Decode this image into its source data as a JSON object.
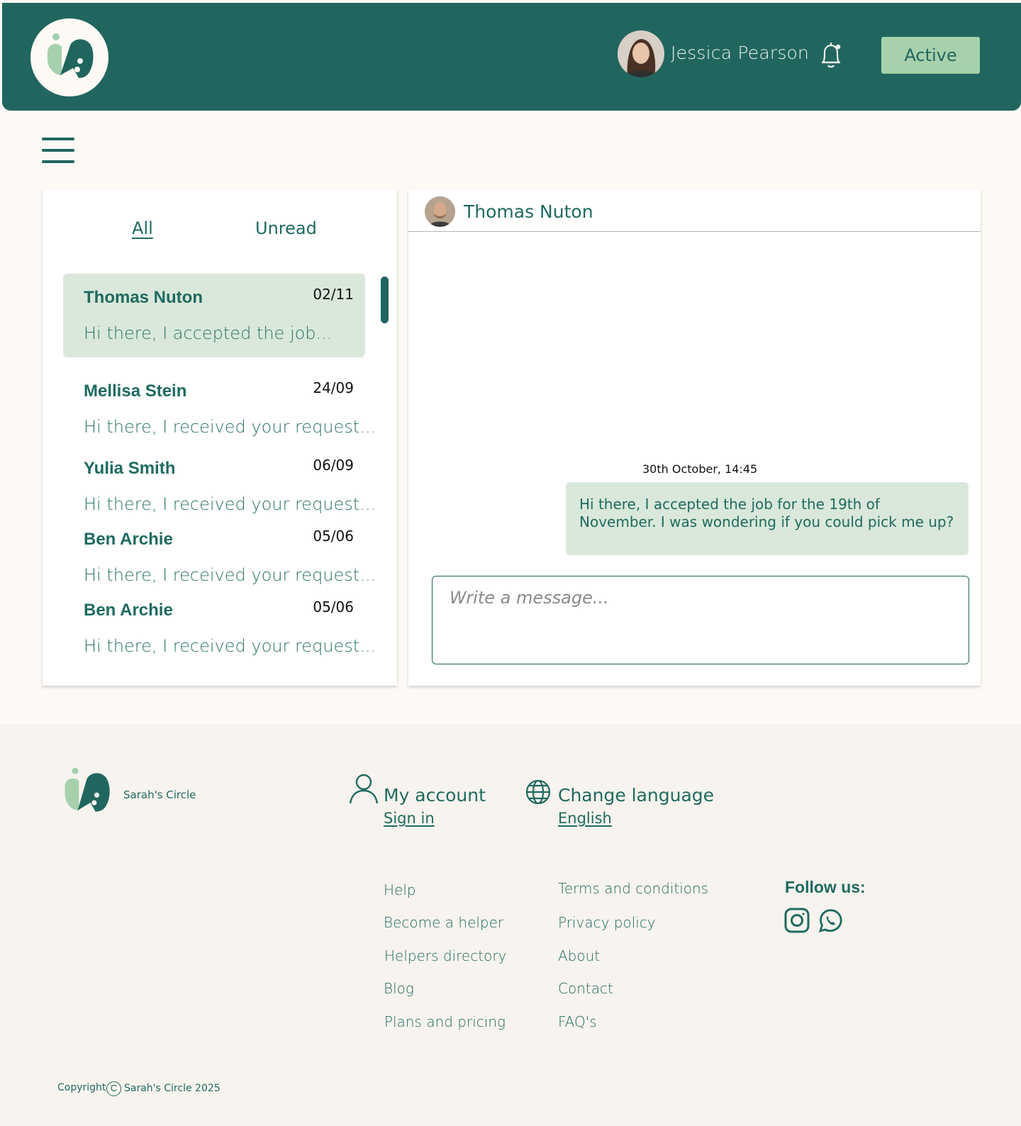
{
  "header": {
    "user_name": "Jessica Pearson",
    "status_label": "Active",
    "colors": {
      "header_bg": "#20665f",
      "status_bg": "#a6d1ac",
      "page_bg": "#fdf9f5"
    }
  },
  "tabs": {
    "all": "All",
    "unread": "Unread"
  },
  "conversations": [
    {
      "name": "Thomas Nuton",
      "date": "02/11",
      "preview": "Hi there, I accepted the job...",
      "active": true
    },
    {
      "name": "Mellisa Stein",
      "date": "24/09",
      "preview": "Hi there, I received your request..."
    },
    {
      "name": "Yulia Smith",
      "date": "06/09",
      "preview": "Hi there, I received your request..."
    },
    {
      "name": "Ben Archie",
      "date": "05/06",
      "preview": "Hi there, I received your request..."
    },
    {
      "name": "Ben Archie",
      "date": "05/06",
      "preview": "Hi there, I received your request..."
    }
  ],
  "chat": {
    "contact_name": "Thomas Nuton",
    "message_time": "30th October, 14:45",
    "message_text": "Hi there, I accepted the job for the 19th of November. I was wondering if you could pick me up?",
    "input_placeholder": "Write a message..."
  },
  "footer": {
    "brand": "Sarah's Circle",
    "account_heading": "My account",
    "account_link": "Sign in",
    "language_heading": "Change language",
    "language_link": "English",
    "links_col1": [
      "Help",
      "Become a helper",
      "Helpers directory",
      "Blog",
      "Plans and pricing"
    ],
    "links_col2": [
      "Terms and conditions",
      "Privacy policy",
      "About",
      "Contact",
      "FAQ's"
    ],
    "follow": "Follow us:",
    "social_icons": [
      "instagram-icon",
      "whatsapp-icon"
    ],
    "copyright_label": "Copyright",
    "copyright_symbol": "C",
    "copyright_text": "Sarah's Circle 2025"
  }
}
